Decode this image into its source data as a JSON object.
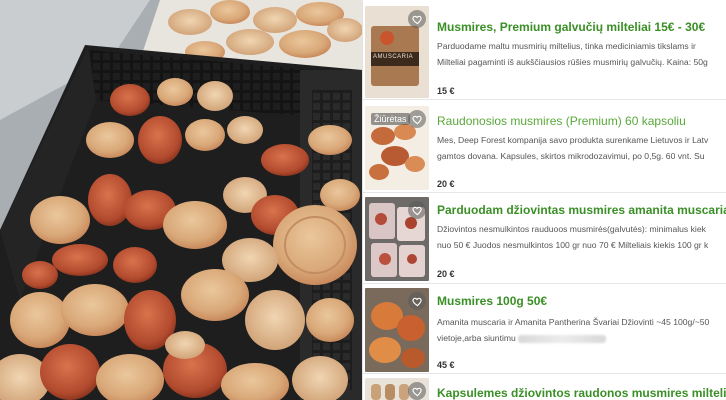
{
  "listings": [
    {
      "title": "Musmires, Premium galvučių milteliai 15€ - 30€",
      "desc_line1": "Parduodame maltu musmirių miltelius, tinka mediciniamis tikslams ir",
      "desc_line2": "Milteliai pagaminti iš aukščiausios rūšies musmirių galvučių. Kaina: 50g",
      "price": "15 €",
      "thumb_text": "AMUSCARIA"
    },
    {
      "title": "Raudonosios musmires (Premium) 60 kapsoliu",
      "badge": "Žiūrėtas",
      "desc_line1": "Mes, Deep Forest kompanija savo produkta surenkame Lietuvos ir Latv",
      "desc_line2": "gamtos dovana. Kapsules, skirtos mikrodozavimui, po 0,5g. 60 vnt. Su",
      "price": "20 €"
    },
    {
      "title": "Parduodam džiovintas musmires amanita muscaria",
      "desc_line1": "Džiovintos nesmulkintos rauduoos musmirės(galvutės): minimalus kiek",
      "desc_line2": "nuo 50 € Juodos nesmulkintos 100 gr nuo 70 € Milteliais kiekis 100 gr k",
      "price": "20 €"
    },
    {
      "title": "Musmires 100g 50€",
      "desc_line1": "Amanita muscaria ir Amanita Pantherina Švariai Džiovinti ~45 100g/~50",
      "desc_line2": "vietoje,arba siuntimu",
      "price": "45 €"
    },
    {
      "title": "Kapsulemes džiovintos raudonos musmires milteliais"
    }
  ],
  "colors": {
    "title_green": "#3a8f26",
    "title_green_light": "#5aa83a",
    "mushroom_cap": "#c0563a",
    "mushroom_flesh": "#e2b98e",
    "crate": "#1d1d1d"
  },
  "icons": {
    "favorite": "heart-icon"
  }
}
